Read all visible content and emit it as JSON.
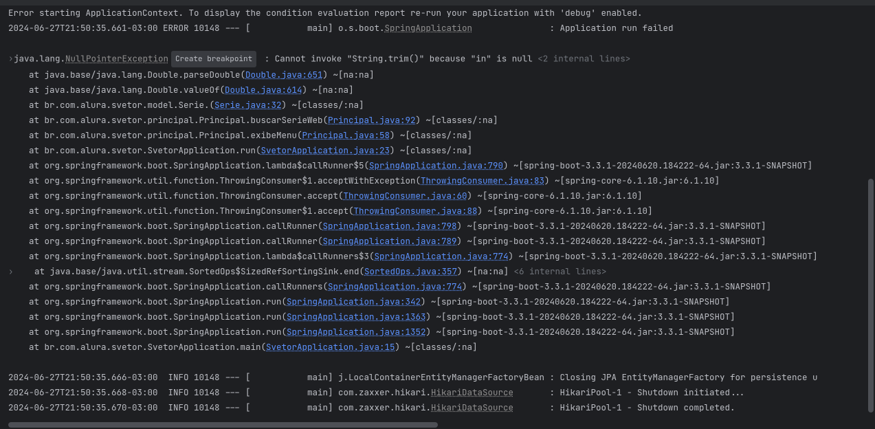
{
  "header": {
    "errorStart": "Error starting ApplicationContext. To display the condition evaluation report re-run your application with 'debug' enabled.",
    "ts": "2024-06-27T21:50:35.661-03:00 ERROR 10148 --- [           main] o.s.boot.",
    "springApp": "SpringApplication",
    "failedMsg": "               : Application run failed"
  },
  "exception": {
    "prefix": "java.lang.",
    "type": "NullPointerException",
    "breakpoint": "Create breakpoint",
    "message": " : Cannot invoke \"String.trim()\" because \"in\" is null ",
    "internal1": "<2 internal lines>"
  },
  "stack": [
    {
      "pre": "    at java.base/java.lang.Double.parseDouble(",
      "link": "Double.java:651",
      "post": ") ~[na:na]"
    },
    {
      "pre": "    at java.base/java.lang.Double.valueOf(",
      "link": "Double.java:614",
      "post": ") ~[na:na]"
    },
    {
      "pre": "    at br.com.alura.svetor.model.Serie.<init>(",
      "link": "Serie.java:32",
      "post": ") ~[classes/:na]"
    },
    {
      "pre": "    at br.com.alura.svetor.principal.Principal.buscarSerieWeb(",
      "link": "Principal.java:92",
      "post": ") ~[classes/:na]"
    },
    {
      "pre": "    at br.com.alura.svetor.principal.Principal.exibeMenu(",
      "link": "Principal.java:58",
      "post": ") ~[classes/:na]"
    },
    {
      "pre": "    at br.com.alura.svetor.SvetorApplication.run(",
      "link": "SvetorApplication.java:23",
      "post": ") ~[classes/:na]"
    },
    {
      "pre": "    at org.springframework.boot.SpringApplication.lambda$callRunner$5(",
      "link": "SpringApplication.java:790",
      "post": ") ~[spring-boot-3.3.1-20240620.184222-64.jar:3.3.1-SNAPSHOT]"
    },
    {
      "pre": "    at org.springframework.util.function.ThrowingConsumer$1.acceptWithException(",
      "link": "ThrowingConsumer.java:83",
      "post": ") ~[spring-core-6.1.10.jar:6.1.10]"
    },
    {
      "pre": "    at org.springframework.util.function.ThrowingConsumer.accept(",
      "link": "ThrowingConsumer.java:60",
      "post": ") ~[spring-core-6.1.10.jar:6.1.10]"
    },
    {
      "pre": "    at org.springframework.util.function.ThrowingConsumer$1.accept(",
      "link": "ThrowingConsumer.java:88",
      "post": ") ~[spring-core-6.1.10.jar:6.1.10]"
    },
    {
      "pre": "    at org.springframework.boot.SpringApplication.callRunner(",
      "link": "SpringApplication.java:798",
      "post": ") ~[spring-boot-3.3.1-20240620.184222-64.jar:3.3.1-SNAPSHOT]"
    },
    {
      "pre": "    at org.springframework.boot.SpringApplication.callRunner(",
      "link": "SpringApplication.java:789",
      "post": ") ~[spring-boot-3.3.1-20240620.184222-64.jar:3.3.1-SNAPSHOT]"
    },
    {
      "pre": "    at org.springframework.boot.SpringApplication.lambda$callRunners$3(",
      "link": "SpringApplication.java:774",
      "post": ") ~[spring-boot-3.3.1-20240620.184222-64.jar:3.3.1-SNAPSHOT]"
    },
    {
      "pre": "    at java.base/java.util.stream.SortedOps$SizedRefSortingSink.end(",
      "link": "SortedOps.java:357",
      "post": ") ~[na:na] ",
      "internal": "<6 internal lines>",
      "arrow": true
    },
    {
      "pre": "    at org.springframework.boot.SpringApplication.callRunners(",
      "link": "SpringApplication.java:774",
      "post": ") ~[spring-boot-3.3.1-20240620.184222-64.jar:3.3.1-SNAPSHOT]"
    },
    {
      "pre": "    at org.springframework.boot.SpringApplication.run(",
      "link": "SpringApplication.java:342",
      "post": ") ~[spring-boot-3.3.1-20240620.184222-64.jar:3.3.1-SNAPSHOT]"
    },
    {
      "pre": "    at org.springframework.boot.SpringApplication.run(",
      "link": "SpringApplication.java:1363",
      "post": ") ~[spring-boot-3.3.1-20240620.184222-64.jar:3.3.1-SNAPSHOT]"
    },
    {
      "pre": "    at org.springframework.boot.SpringApplication.run(",
      "link": "SpringApplication.java:1352",
      "post": ") ~[spring-boot-3.3.1-20240620.184222-64.jar:3.3.1-SNAPSHOT]"
    },
    {
      "pre": "    at br.com.alura.svetor.SvetorApplication.main(",
      "link": "SvetorApplication.java:15",
      "post": ") ~[classes/:na]"
    }
  ],
  "footer": [
    {
      "pre": "2024-06-27T21:50:35.666-03:00  INFO 10148 --- [           main] j.LocalContainerEntityManagerFactoryBean : Closing JPA EntityManagerFactory for persistence u"
    },
    {
      "pre": "2024-06-27T21:50:35.668-03:00  INFO 10148 --- [           main] com.zaxxer.hikari.",
      "link": "HikariDataSource",
      "post": "       : HikariPool-1 - Shutdown initiated..."
    },
    {
      "pre": "2024-06-27T21:50:35.670-03:00  INFO 10148 --- [           main] com.zaxxer.hikari.",
      "link": "HikariDataSource",
      "post": "       : HikariPool-1 - Shutdown completed."
    }
  ]
}
